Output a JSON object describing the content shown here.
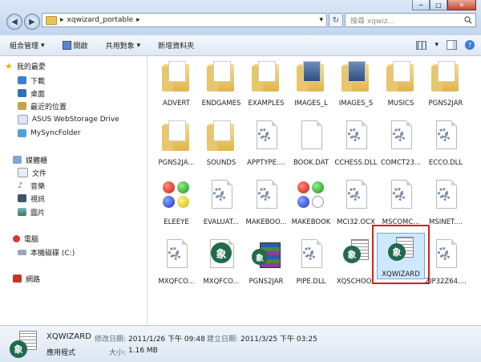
{
  "window": {
    "controls": {
      "minimize": "─",
      "maximize": "□",
      "close": "✕"
    }
  },
  "address": {
    "back": "◀",
    "forward": "▶",
    "segments": [
      "xqwizard_portable"
    ],
    "separator": "▸",
    "dropdown": "▾",
    "refresh": "↻"
  },
  "search": {
    "placeholder": "搜尋 xqwiz...",
    "icon": "search-icon"
  },
  "toolbar": {
    "organize": "組合管理",
    "open": "開啟",
    "share": "共用對象",
    "new_folder": "新增資料夾",
    "dropdown_mark": "▾",
    "help": "?"
  },
  "sidebar": {
    "favorites": {
      "title": "我的最愛",
      "items": [
        "下載",
        "桌面",
        "最近的位置",
        "ASUS WebStorage Drive",
        "MySyncFolder"
      ]
    },
    "libraries": {
      "title": "媒體櫃",
      "items": [
        "文件",
        "音樂",
        "視訊",
        "圖片"
      ]
    },
    "computer": {
      "title": "電腦",
      "items": [
        "本機磁碟 (C:)"
      ]
    },
    "network": {
      "title": "網路"
    }
  },
  "files": [
    {
      "name": "ADVERT",
      "kind": "folder"
    },
    {
      "name": "ENDGAMES",
      "kind": "folder"
    },
    {
      "name": "EXAMPLES",
      "kind": "folder"
    },
    {
      "name": "IMAGES_L",
      "kind": "folder-pic"
    },
    {
      "name": "IMAGES_S",
      "kind": "folder-pic"
    },
    {
      "name": "MUSICS",
      "kind": "folder"
    },
    {
      "name": "PGNS2JAR",
      "kind": "folder"
    },
    {
      "name": "PGNS2JA...",
      "kind": "folder"
    },
    {
      "name": "SOUNDS",
      "kind": "folder"
    },
    {
      "name": "APPTYPE....",
      "kind": "dll"
    },
    {
      "name": "BOOK.DAT",
      "kind": "doc"
    },
    {
      "name": "CCHESS.DLL",
      "kind": "dll"
    },
    {
      "name": "COMCT23...",
      "kind": "dll"
    },
    {
      "name": "ECCO.DLL",
      "kind": "dll"
    },
    {
      "name": "ELEEYE",
      "kind": "balls"
    },
    {
      "name": "EVALUAT...",
      "kind": "dll"
    },
    {
      "name": "MAKEBOO...",
      "kind": "dll"
    },
    {
      "name": "MAKEBOOK",
      "kind": "balls"
    },
    {
      "name": "MCI32.OCX",
      "kind": "dll"
    },
    {
      "name": "MSCOMC...",
      "kind": "dll"
    },
    {
      "name": "MSINET....",
      "kind": "dll"
    },
    {
      "name": "MXQFCO...",
      "kind": "dll"
    },
    {
      "name": "MXQFCO...",
      "kind": "xq"
    },
    {
      "name": "PGNS2JAR",
      "kind": "xqrar"
    },
    {
      "name": "PIPE.DLL",
      "kind": "dll"
    },
    {
      "name": "XQSCHOOL",
      "kind": "xq"
    },
    {
      "name": "XQWIZARD",
      "kind": "xq"
    },
    {
      "name": "ZIP32Z64....",
      "kind": "dll"
    }
  ],
  "xq_glyph": "象",
  "status": {
    "name": "XQWIZARD",
    "type": "應用程式",
    "modified_label": "修改日期:",
    "modified": "2011/1/26 下午 09:48",
    "created_label": "建立日期:",
    "created": "2011/3/25 下午 03:25",
    "size_label": "大小:",
    "size": "1.16 MB"
  }
}
